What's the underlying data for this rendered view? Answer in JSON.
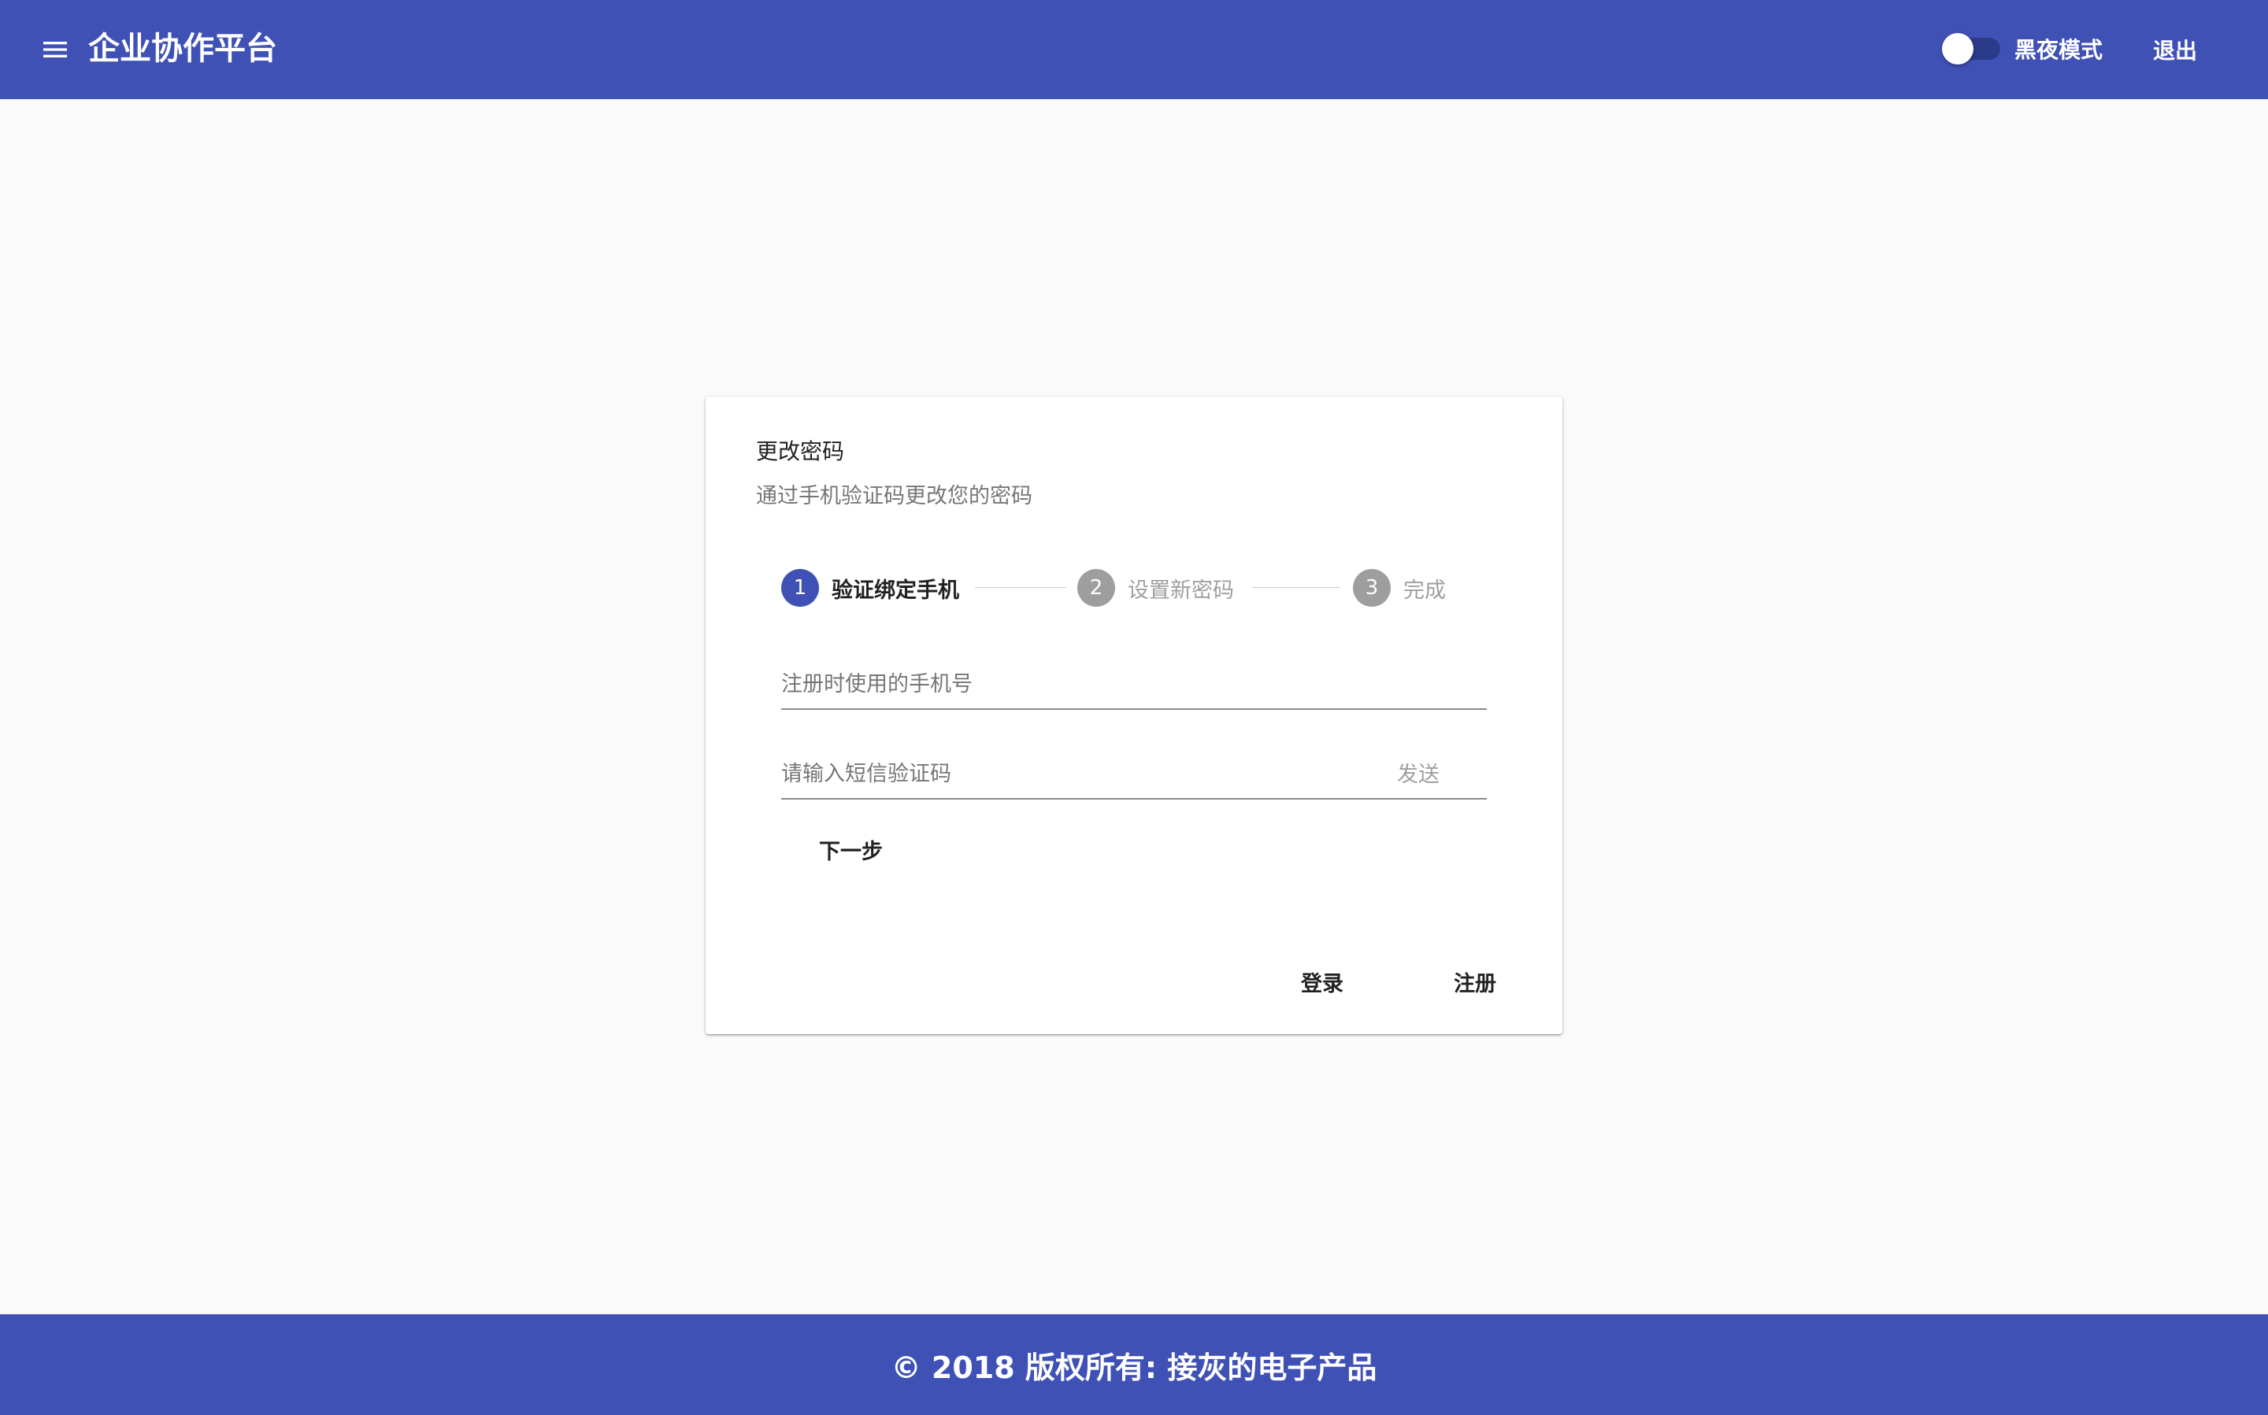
{
  "header": {
    "app_title": "企业协作平台",
    "menu_icon": "menu-icon",
    "dark_mode_label": "黑夜模式",
    "dark_mode_on": false,
    "logout_label": "退出"
  },
  "card": {
    "title": "更改密码",
    "subtitle": "通过手机验证码更改您的密码",
    "steps": [
      {
        "number": "1",
        "label": "验证绑定手机",
        "state": "active"
      },
      {
        "number": "2",
        "label": "设置新密码",
        "state": "inactive"
      },
      {
        "number": "3",
        "label": "完成",
        "state": "inactive"
      }
    ],
    "phone_field": {
      "value": "",
      "placeholder": "注册时使用的手机号"
    },
    "sms_field": {
      "value": "",
      "placeholder": "请输入短信验证码"
    },
    "send_label": "发送",
    "next_label": "下一步",
    "login_label": "登录",
    "register_label": "注册"
  },
  "footer": {
    "text": "© 2018 版权所有: 接灰的电子产品"
  },
  "colors": {
    "primary": "#3f51b5",
    "step_inactive": "#9e9e9e",
    "background": "#fafafa"
  }
}
